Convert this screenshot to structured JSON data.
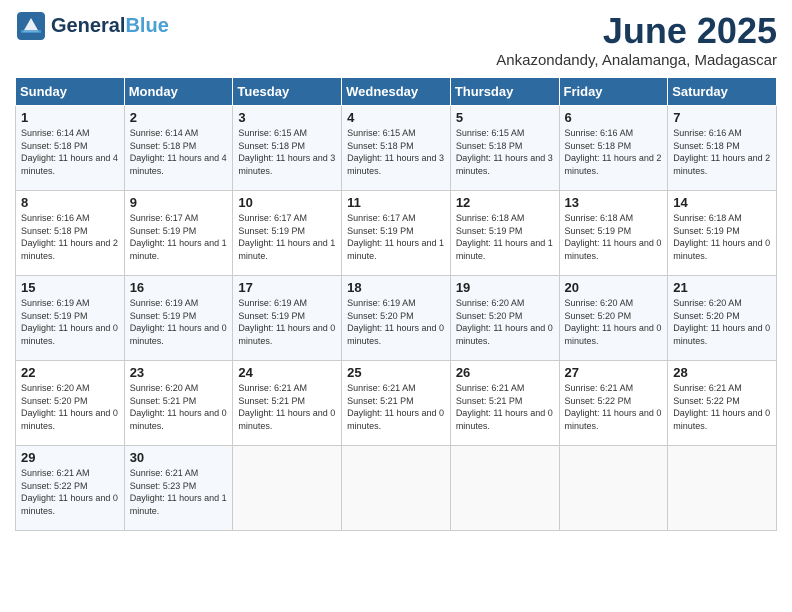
{
  "header": {
    "logo_line1": "General",
    "logo_line2": "Blue",
    "title": "June 2025",
    "subtitle": "Ankazondandy, Analamanga, Madagascar"
  },
  "columns": [
    "Sunday",
    "Monday",
    "Tuesday",
    "Wednesday",
    "Thursday",
    "Friday",
    "Saturday"
  ],
  "weeks": [
    [
      {
        "day": "1",
        "sunrise": "6:14 AM",
        "sunset": "5:18 PM",
        "daylight": "11 hours and 4 minutes."
      },
      {
        "day": "2",
        "sunrise": "6:14 AM",
        "sunset": "5:18 PM",
        "daylight": "11 hours and 4 minutes."
      },
      {
        "day": "3",
        "sunrise": "6:15 AM",
        "sunset": "5:18 PM",
        "daylight": "11 hours and 3 minutes."
      },
      {
        "day": "4",
        "sunrise": "6:15 AM",
        "sunset": "5:18 PM",
        "daylight": "11 hours and 3 minutes."
      },
      {
        "day": "5",
        "sunrise": "6:15 AM",
        "sunset": "5:18 PM",
        "daylight": "11 hours and 3 minutes."
      },
      {
        "day": "6",
        "sunrise": "6:16 AM",
        "sunset": "5:18 PM",
        "daylight": "11 hours and 2 minutes."
      },
      {
        "day": "7",
        "sunrise": "6:16 AM",
        "sunset": "5:18 PM",
        "daylight": "11 hours and 2 minutes."
      }
    ],
    [
      {
        "day": "8",
        "sunrise": "6:16 AM",
        "sunset": "5:18 PM",
        "daylight": "11 hours and 2 minutes."
      },
      {
        "day": "9",
        "sunrise": "6:17 AM",
        "sunset": "5:19 PM",
        "daylight": "11 hours and 1 minute."
      },
      {
        "day": "10",
        "sunrise": "6:17 AM",
        "sunset": "5:19 PM",
        "daylight": "11 hours and 1 minute."
      },
      {
        "day": "11",
        "sunrise": "6:17 AM",
        "sunset": "5:19 PM",
        "daylight": "11 hours and 1 minute."
      },
      {
        "day": "12",
        "sunrise": "6:18 AM",
        "sunset": "5:19 PM",
        "daylight": "11 hours and 1 minute."
      },
      {
        "day": "13",
        "sunrise": "6:18 AM",
        "sunset": "5:19 PM",
        "daylight": "11 hours and 0 minutes."
      },
      {
        "day": "14",
        "sunrise": "6:18 AM",
        "sunset": "5:19 PM",
        "daylight": "11 hours and 0 minutes."
      }
    ],
    [
      {
        "day": "15",
        "sunrise": "6:19 AM",
        "sunset": "5:19 PM",
        "daylight": "11 hours and 0 minutes."
      },
      {
        "day": "16",
        "sunrise": "6:19 AM",
        "sunset": "5:19 PM",
        "daylight": "11 hours and 0 minutes."
      },
      {
        "day": "17",
        "sunrise": "6:19 AM",
        "sunset": "5:19 PM",
        "daylight": "11 hours and 0 minutes."
      },
      {
        "day": "18",
        "sunrise": "6:19 AM",
        "sunset": "5:20 PM",
        "daylight": "11 hours and 0 minutes."
      },
      {
        "day": "19",
        "sunrise": "6:20 AM",
        "sunset": "5:20 PM",
        "daylight": "11 hours and 0 minutes."
      },
      {
        "day": "20",
        "sunrise": "6:20 AM",
        "sunset": "5:20 PM",
        "daylight": "11 hours and 0 minutes."
      },
      {
        "day": "21",
        "sunrise": "6:20 AM",
        "sunset": "5:20 PM",
        "daylight": "11 hours and 0 minutes."
      }
    ],
    [
      {
        "day": "22",
        "sunrise": "6:20 AM",
        "sunset": "5:20 PM",
        "daylight": "11 hours and 0 minutes."
      },
      {
        "day": "23",
        "sunrise": "6:20 AM",
        "sunset": "5:21 PM",
        "daylight": "11 hours and 0 minutes."
      },
      {
        "day": "24",
        "sunrise": "6:21 AM",
        "sunset": "5:21 PM",
        "daylight": "11 hours and 0 minutes."
      },
      {
        "day": "25",
        "sunrise": "6:21 AM",
        "sunset": "5:21 PM",
        "daylight": "11 hours and 0 minutes."
      },
      {
        "day": "26",
        "sunrise": "6:21 AM",
        "sunset": "5:21 PM",
        "daylight": "11 hours and 0 minutes."
      },
      {
        "day": "27",
        "sunrise": "6:21 AM",
        "sunset": "5:22 PM",
        "daylight": "11 hours and 0 minutes."
      },
      {
        "day": "28",
        "sunrise": "6:21 AM",
        "sunset": "5:22 PM",
        "daylight": "11 hours and 0 minutes."
      }
    ],
    [
      {
        "day": "29",
        "sunrise": "6:21 AM",
        "sunset": "5:22 PM",
        "daylight": "11 hours and 0 minutes."
      },
      {
        "day": "30",
        "sunrise": "6:21 AM",
        "sunset": "5:23 PM",
        "daylight": "11 hours and 1 minute."
      },
      null,
      null,
      null,
      null,
      null
    ]
  ],
  "labels": {
    "sunrise": "Sunrise: ",
    "sunset": "Sunset: ",
    "daylight": "Daylight: "
  }
}
